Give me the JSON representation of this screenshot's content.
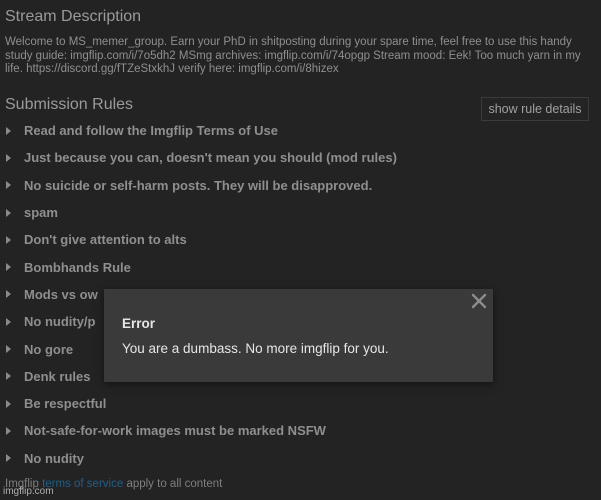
{
  "stream": {
    "title": "Stream Description",
    "description": "Welcome to MS_memer_group. Earn your PhD in shitposting during your spare time, feel free to use this handy study guide: imgflip.com/i/7o5dh2 MSmg archives: imgflip.com/i/74opgp Stream mood: Eek! Too much yarn in my life. https://discord.gg/fTZeStxkhJ verify here: imgflip.com/i/8hizex"
  },
  "rules": {
    "title": "Submission Rules",
    "details_button_label": "show rule details",
    "items": [
      {
        "label": "Read and follow the Imgflip Terms of Use"
      },
      {
        "label": "Just because you can, doesn't mean you should (mod rules)"
      },
      {
        "label": "No suicide or self-harm posts. They will be disapproved."
      },
      {
        "label": "spam"
      },
      {
        "label": "Don't give attention to alts"
      },
      {
        "label": "Bombhands Rule"
      },
      {
        "label": "Mods vs ow"
      },
      {
        "label": "No nudity/p"
      },
      {
        "label": "No gore"
      },
      {
        "label": "Denk rules"
      },
      {
        "label": "Be respectful"
      },
      {
        "label": "Not-safe-for-work images must be marked NSFW"
      },
      {
        "label": "No nudity"
      }
    ]
  },
  "footer": {
    "prefix": "Imgflip ",
    "link": "terms of service",
    "suffix": " apply to all content"
  },
  "watermark": "imgflip.com",
  "error_dialog": {
    "title": "Error",
    "message": "You are a dumbass. No more imgflip for you.",
    "close_icon": "close-icon"
  },
  "colors": {
    "background": "#232323",
    "dialog_background": "#3a3a3a",
    "text": "#9a9a9a",
    "link": "#1f5f8a"
  }
}
